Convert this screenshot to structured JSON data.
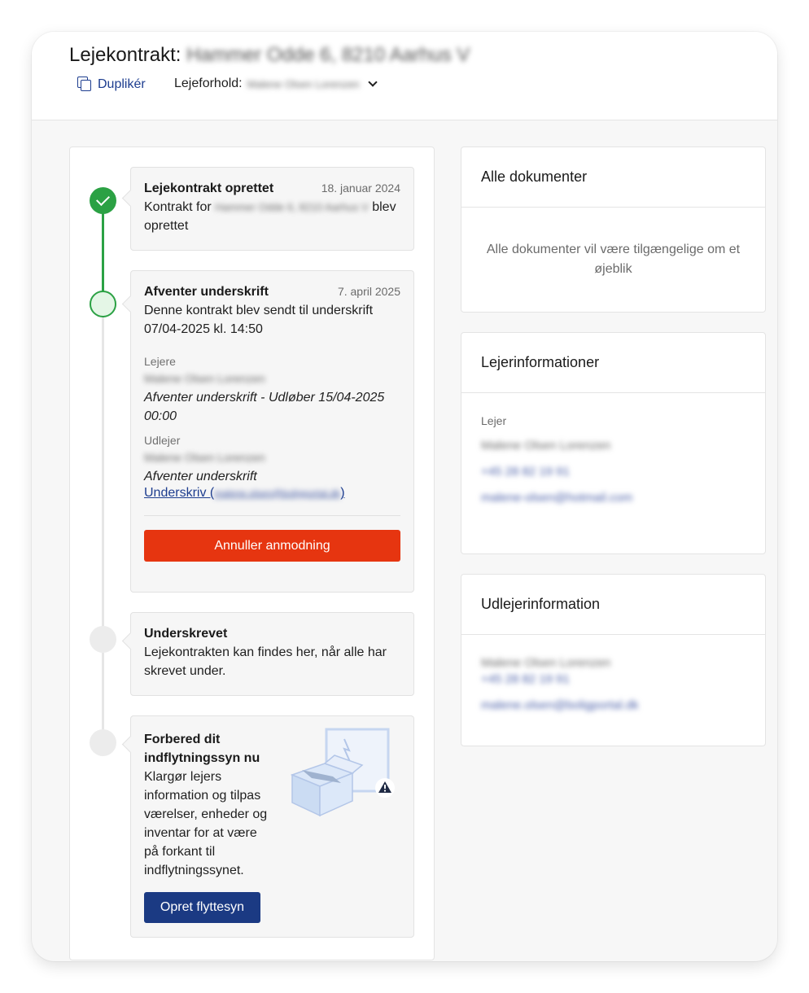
{
  "header": {
    "title_prefix": "Lejekontrakt:",
    "title_address": "Hammer Odde 6, 8210 Aarhus V",
    "duplicate_label": "Duplikér",
    "lease_label": "Lejeforhold:",
    "lease_value": "Malene Olsen Lorenzen"
  },
  "timeline": {
    "steps": [
      {
        "title": "Lejekontrakt oprettet",
        "date": "18. januar 2024",
        "text_prefix": "Kontrakt for",
        "text_address": "Hammer Odde 6, 8210 Aarhus V",
        "text_suffix": "blev oprettet"
      },
      {
        "title": "Afventer underskrift",
        "date": "7. april 2025",
        "text": "Denne kontrakt blev sendt til underskrift 07/04-2025 kl. 14:50",
        "tenant_label": "Lejere",
        "tenant_name": "Malene Olsen Lorenzen",
        "tenant_status": "Afventer underskrift - Udløber 15/04-2025 00:00",
        "landlord_label": "Udlejer",
        "landlord_name": "Malene Olsen Lorenzen",
        "landlord_status": "Afventer underskrift",
        "sign_link_prefix": "Underskriv (",
        "sign_link_email": "malene.olsen@boligportal.dk",
        "sign_link_suffix": ")",
        "cancel_label": "Annuller anmodning"
      },
      {
        "title": "Underskrevet",
        "text": "Lejekontrakten kan findes her, når alle har skrevet under."
      },
      {
        "title": "Forbered dit indflytningssyn nu",
        "text": "Klargør lejers information og tilpas værelser, enheder og inventar for at være på forkant til indflytningssynet.",
        "button_label": "Opret flyttesyn"
      }
    ]
  },
  "documents": {
    "title": "Alle dokumenter",
    "message": "Alle dokumenter vil være tilgængelige om et øjeblik"
  },
  "tenant_info": {
    "title": "Lejerinformationer",
    "label": "Lejer",
    "name": "Malene Olsen Lorenzen",
    "phone": "+45 28 82 19 91",
    "email": "malene-olsen@hotmail.com"
  },
  "landlord_info": {
    "title": "Udlejerinformation",
    "name": "Malene Olsen Lorenzen",
    "phone": "+45 28 82 19 91",
    "email": "malene.olsen@boligportal.dk"
  },
  "colors": {
    "accent_green": "#2ba144",
    "primary_blue": "#1b3a83",
    "danger_red": "#e63510"
  }
}
